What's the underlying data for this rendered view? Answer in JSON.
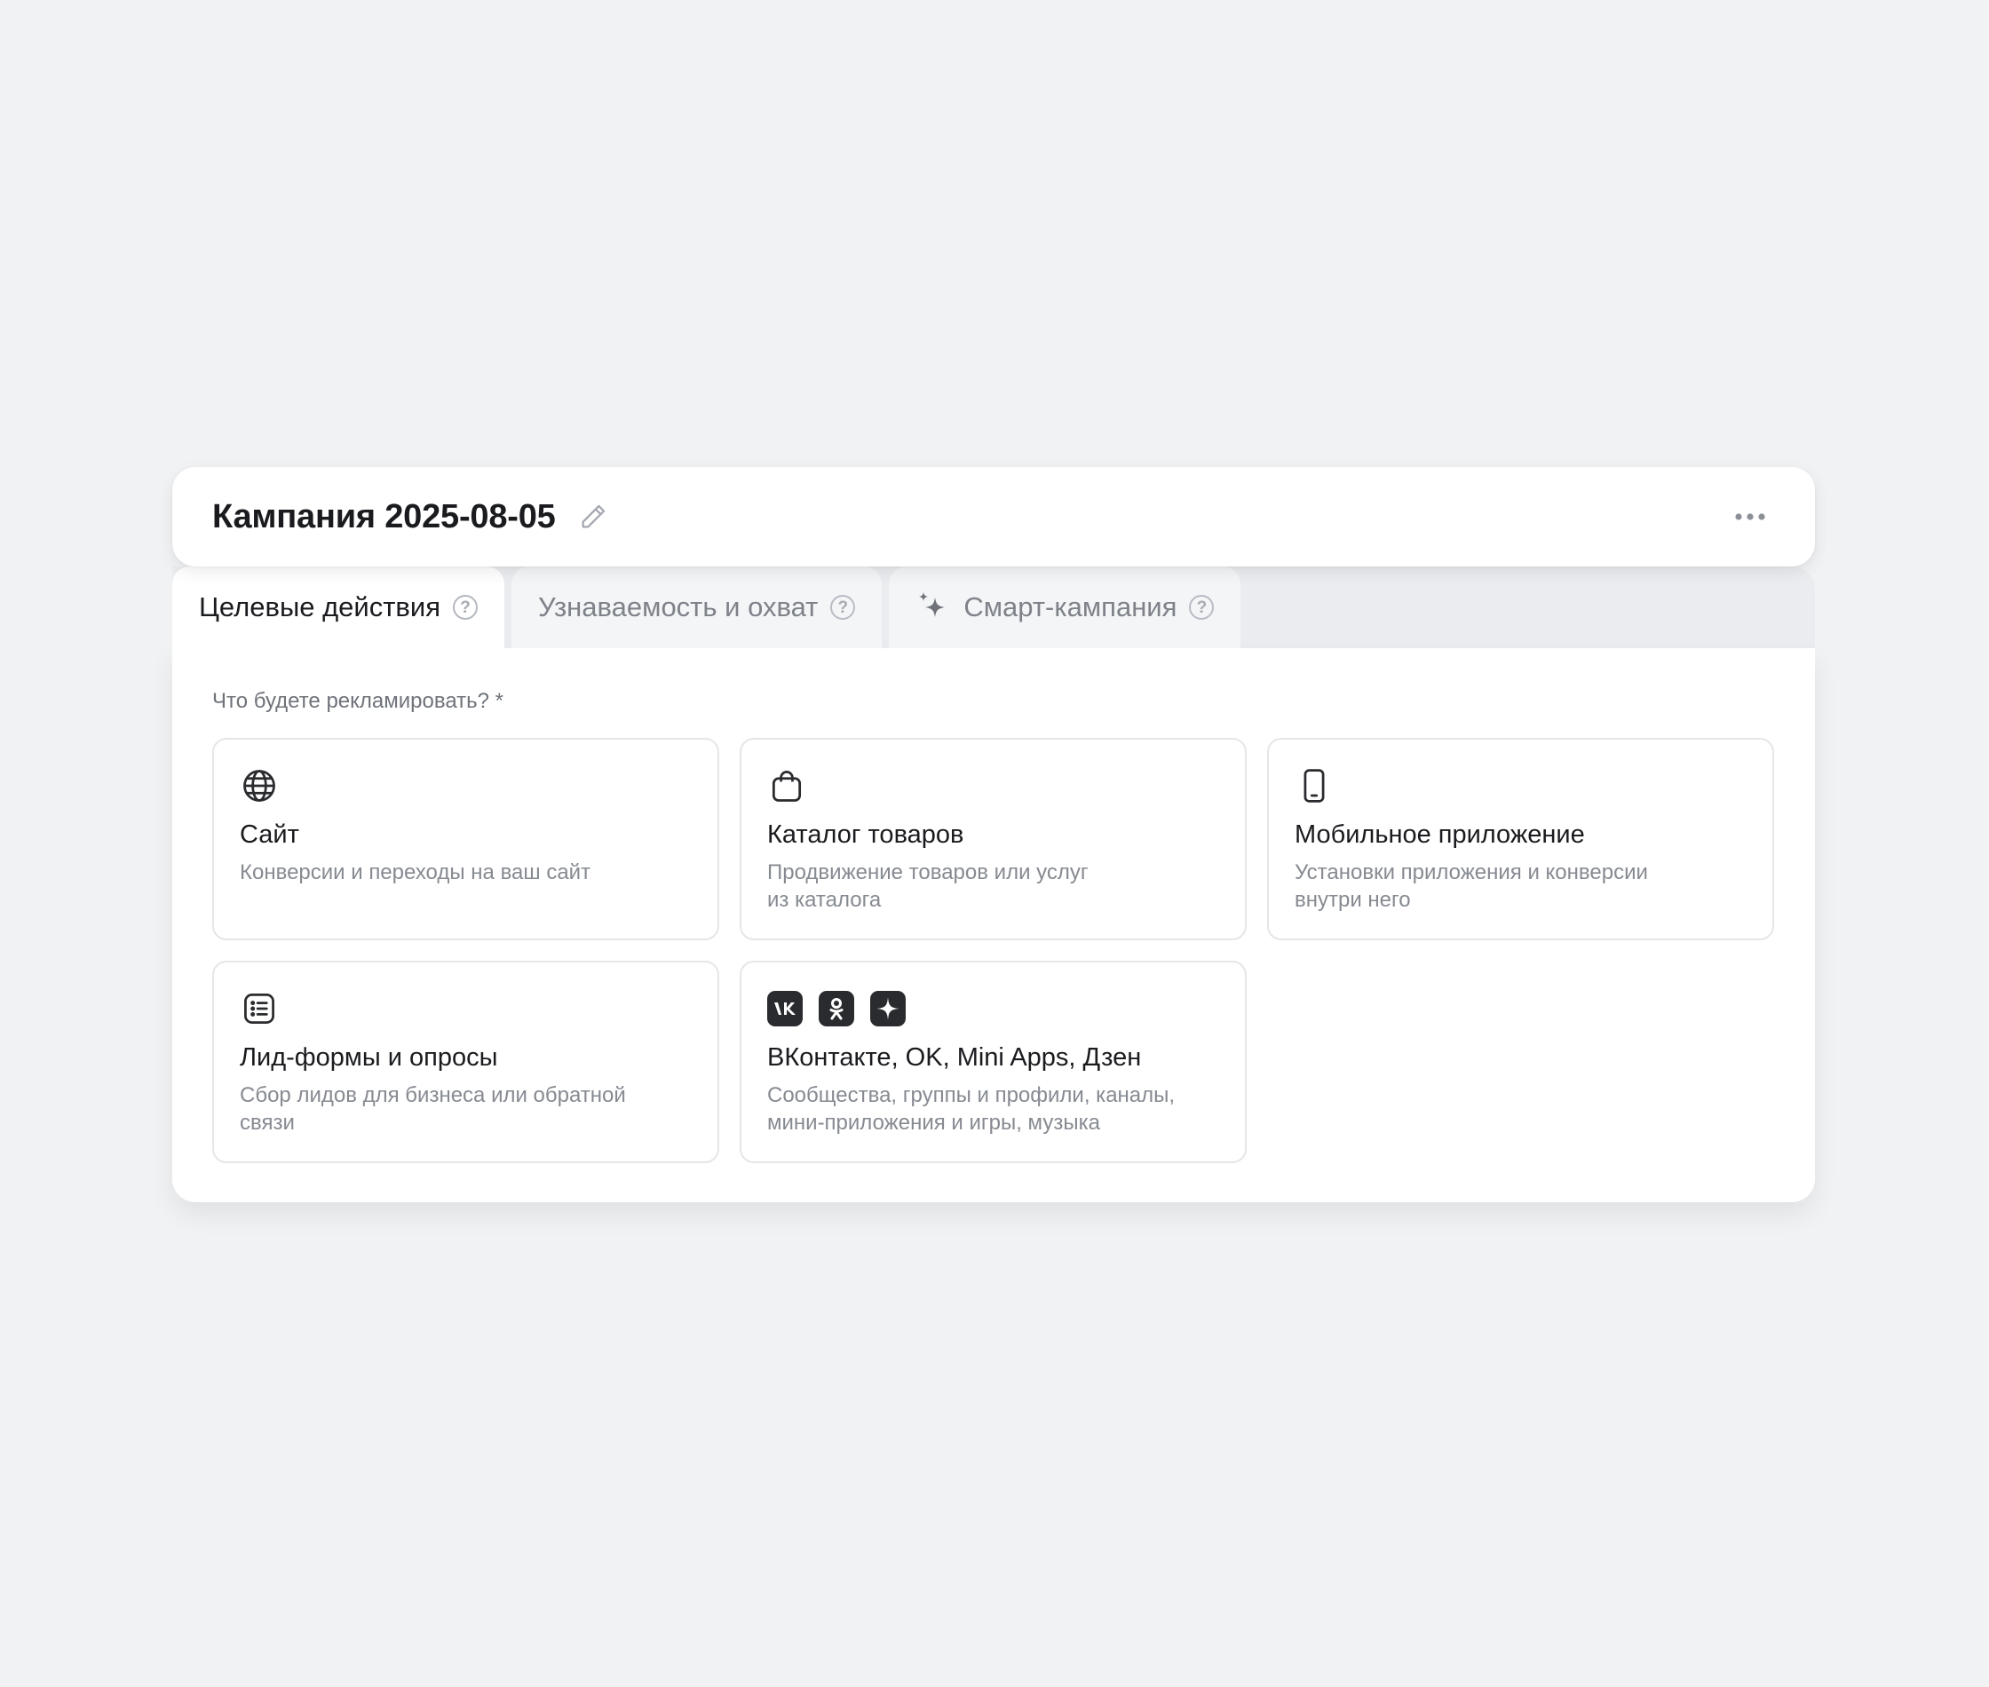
{
  "header": {
    "title": "Кампания 2025-08-05",
    "edit_icon": "pencil-icon",
    "more_icon": "more-horizontal-icon"
  },
  "tabs": [
    {
      "label": "Целевые действия",
      "active": true
    },
    {
      "label": "Узнаваемость и охват",
      "active": false
    },
    {
      "label": "Смарт-кампания",
      "active": false,
      "icon": "sparkle-icon"
    }
  ],
  "help_glyph": "?",
  "question": "Что будете рекламировать? *",
  "cards": [
    {
      "icon": "globe-icon",
      "title": "Сайт",
      "desc": "Конверсии и переходы на ваш сайт"
    },
    {
      "icon": "shopping-bag-icon",
      "title": "Каталог товаров",
      "desc": "Продвижение товаров или услуг\nиз каталога"
    },
    {
      "icon": "smartphone-icon",
      "title": "Мобильное приложение",
      "desc": "Установки приложения и конверсии\nвнутри него"
    },
    {
      "icon": "list-form-icon",
      "title": "Лид-формы и опросы",
      "desc": "Сбор лидов для бизнеса или обратной\nсвязи"
    },
    {
      "icons": [
        "vk-icon",
        "ok-icon",
        "zen-icon"
      ],
      "title": "ВКонтакте, OK, Mini Apps, Дзен",
      "desc": "Сообщества, группы и профили, каналы,\nмини-приложения и игры, музыка"
    }
  ]
}
